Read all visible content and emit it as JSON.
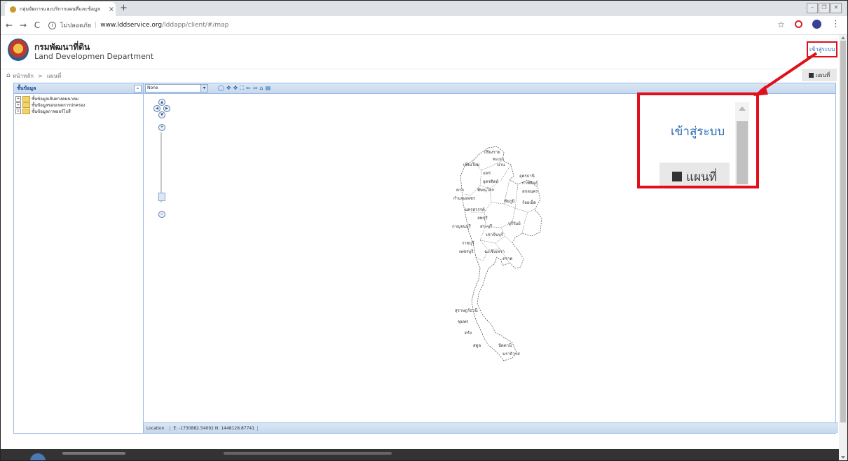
{
  "browser": {
    "tab_title": "กลุ่มจัดการและบริการแผนที่และข้อมูล",
    "tab_close": "×",
    "new_tab": "+",
    "back": "←",
    "forward": "→",
    "reload": "C",
    "info": "i",
    "security_label": "ไม่ปลอดภัย",
    "url_host": "www.lddservice.org",
    "url_path": "/lddapp/client/#/map",
    "star": "☆",
    "menu": "⋮",
    "win_minimize": "–",
    "win_restore": "❐",
    "win_close": "✕"
  },
  "site": {
    "org_name_th": "กรมพัฒนาที่ดิน",
    "org_name_en": "Land Developmen Department",
    "login_link": "เข้าสู่ระบบ"
  },
  "breadcrumb": {
    "home_icon": "home-icon",
    "home": "หน้าหลัก",
    "separator": ">",
    "current": "แผนที่",
    "map_tab": "แผนที่"
  },
  "layers_panel": {
    "title": "ชั้นข้อมูล",
    "collapse": "–",
    "items": [
      {
        "label": "ชั้นข้อมูลเส้นทางคมนาคม"
      },
      {
        "label": "ชั้นข้อมูลขอบเขตการปกครอง"
      },
      {
        "label": "ชั้นข้อมูลภาพออร์โธสี"
      }
    ]
  },
  "map_toolbar": {
    "base_layer": "None",
    "tools": [
      "◯",
      "✥",
      "✥",
      "⛶",
      "⇐",
      "⇒",
      "⌂",
      "▤"
    ]
  },
  "map": {
    "zoom_in": "+",
    "zoom_out": "−",
    "pan_up": "▲",
    "pan_down": "▼",
    "pan_left": "◀",
    "pan_right": "▶",
    "province_labels": [
      "เชียงราย",
      "พะเยา",
      "เชียงใหม่",
      "น่าน",
      "แพร่",
      "อุดรธานี",
      "อุตรดิตถ์",
      "กาฬสินธุ์",
      "ตาก",
      "พิษณุโลก",
      "สกลนคร",
      "กำแพงเพชร",
      "ชัยภูมิ",
      "ร้อยเอ็ด",
      "นครสวรรค์",
      "ลพบุรี",
      "กาญจนบุรี",
      "สระบุรี",
      "บุรีรัมย์",
      "ปราจีนบุรี",
      "ราชบุรี",
      "เพชรบุรี",
      "ฉะเชิงเทรา",
      "ตราด",
      "สุราษฎร์ธานี",
      "ชุมพร",
      "ตรัง",
      "สตูล",
      "ปัตตานี",
      "นราธิวาส"
    ]
  },
  "status": {
    "location_label": "Location",
    "coords": "E: -1730882.54092  N: 1448128.87741"
  },
  "callout": {
    "login": "เข้าสู่ระบบ",
    "map_button": "แผนที่"
  }
}
